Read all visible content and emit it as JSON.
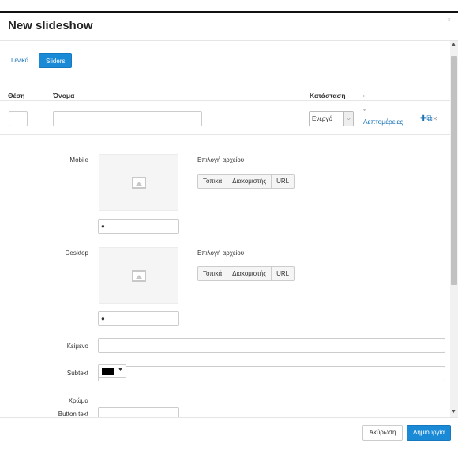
{
  "dialog": {
    "title": "New slideshow",
    "close_label": "×"
  },
  "tabs": [
    {
      "label": "Γενικά",
      "active": false
    },
    {
      "label": "Sliders",
      "active": true
    }
  ],
  "table": {
    "headers": {
      "position": "Θέση",
      "name": "Όνομα",
      "status": "Κατάσταση"
    },
    "row": {
      "position_value": "",
      "name_value": "",
      "status_value": "Ενεργό",
      "details_link": "Λεπτομέρειες"
    }
  },
  "fields": {
    "mobile_label": "Mobile",
    "desktop_label": "Desktop",
    "file_choice_label": "Επιλογή αρχείου",
    "file_buttons": [
      "Τοπικά",
      "Διακομιστής",
      "URL"
    ],
    "text_label": "Κείμενο",
    "subtext_label": "Subtext",
    "color_label": "Χρώμα",
    "color_value": "#000000",
    "button_text_label": "Button text"
  },
  "footer": {
    "cancel_label": "Ακύρωση",
    "create_label": "Δημιουργία"
  },
  "icons": {
    "close": "close-icon",
    "add": "plus-icon",
    "copy": "copy-icon",
    "remove": "remove-icon",
    "image_placeholder": "image-icon",
    "comment": "comment-icon"
  },
  "colors": {
    "accent": "#1a8ad6",
    "link": "#1a73b8"
  }
}
